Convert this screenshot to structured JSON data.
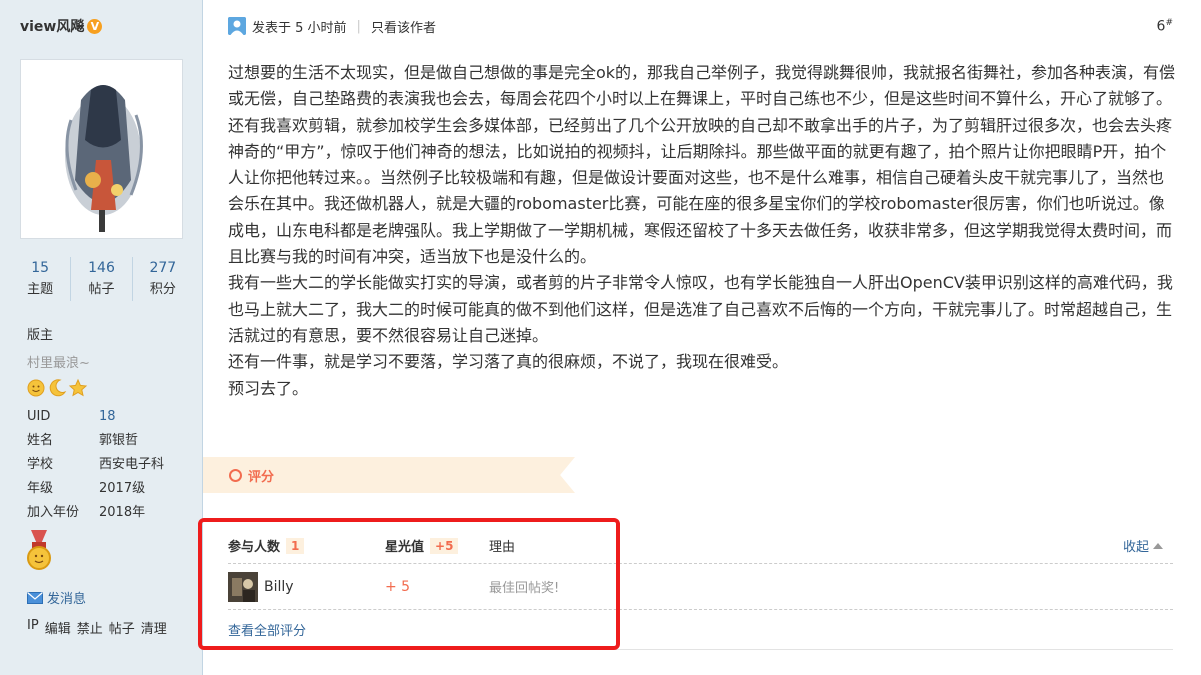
{
  "sidebar": {
    "username": "view风飚",
    "verified_badge": "V",
    "stats": [
      {
        "num": "15",
        "label": "主题"
      },
      {
        "num": "146",
        "label": "帖子"
      },
      {
        "num": "277",
        "label": "积分"
      }
    ],
    "role": "版主",
    "motto": "村里最浪~",
    "medal_icons": [
      "sun-icon",
      "moon-icon",
      "star-icon"
    ],
    "info": [
      {
        "key": "UID",
        "value": "18"
      },
      {
        "key": "姓名",
        "value": "郭银哲"
      },
      {
        "key": "学校",
        "value": "西安电子科"
      },
      {
        "key": "年级",
        "value": "2017级"
      },
      {
        "key": "加入年份",
        "value": "2018年"
      }
    ],
    "send_message": "发消息",
    "admin_links": [
      "IP",
      "编辑",
      "禁止",
      "帖子",
      "清理"
    ]
  },
  "post": {
    "posted": "发表于 5 小时前",
    "only_author": "只看该作者",
    "floor": "6",
    "floor_sup": "#",
    "paragraphs": [
      "过想要的生活不太现实，但是做自己想做的事是完全ok的，那我自己举例子，我觉得跳舞很帅，我就报名街舞社，参加各种表演，有偿或无偿，自己垫路费的表演我也会去，每周会花四个小时以上在舞课上，平时自己练也不少，但是这些时间不算什么，开心了就够了。还有我喜欢剪辑，就参加校学生会多媒体部，已经剪出了几个公开放映的自己却不敢拿出手的片子，为了剪辑肝过很多次，也会去头疼神奇的“甲方”，惊叹于他们神奇的想法，比如说拍的视频抖，让后期除抖。那些做平面的就更有趣了，拍个照片让你把眼睛P开，拍个人让你把他转过来。。当然例子比较极端和有趣，但是做设计要面对这些，也不是什么难事，相信自己硬着头皮干就完事儿了，当然也会乐在其中。我还做机器人，就是大疆的robomaster比赛，可能在座的很多星宝你们的学校robomaster很厉害，你们也听说过。像成电，山东电科都是老牌强队。我上学期做了一学期机械，寒假还留校了十多天去做任务，收获非常多，但这学期我觉得太费时间，而且比赛与我的时间有冲突，适当放下也是没什么的。",
      "我有一些大二的学长能做实打实的导演，或者剪的片子非常令人惊叹，也有学长能独自一人肝出OpenCV装甲识别这样的高难代码，我也马上就大二了，我大二的时候可能真的做不到他们这样，但是选准了自己喜欢不后悔的一个方向，干就完事儿了。时常超越自己，生活就过的有意思，要不然很容易让自己迷掉。",
      "还有一件事，就是学习不要落，学习落了真的很麻烦，不说了，我现在很难受。",
      "预习去了。"
    ]
  },
  "rating": {
    "banner_label": "评分",
    "participants_label": "参与人数",
    "participants_count": "1",
    "star_label": "星光值",
    "star_total": "+5",
    "reason_label": "理由",
    "collapse_label": "收起",
    "rows": [
      {
        "name": "Billy",
        "score": "+ 5",
        "reason": "最佳回帖奖!"
      }
    ],
    "view_all": "查看全部评分"
  },
  "colors": {
    "sidebar_bg": "#e5edf2",
    "link": "#336699",
    "accent": "#f26c4f",
    "highlight": "#ee1c1c"
  }
}
